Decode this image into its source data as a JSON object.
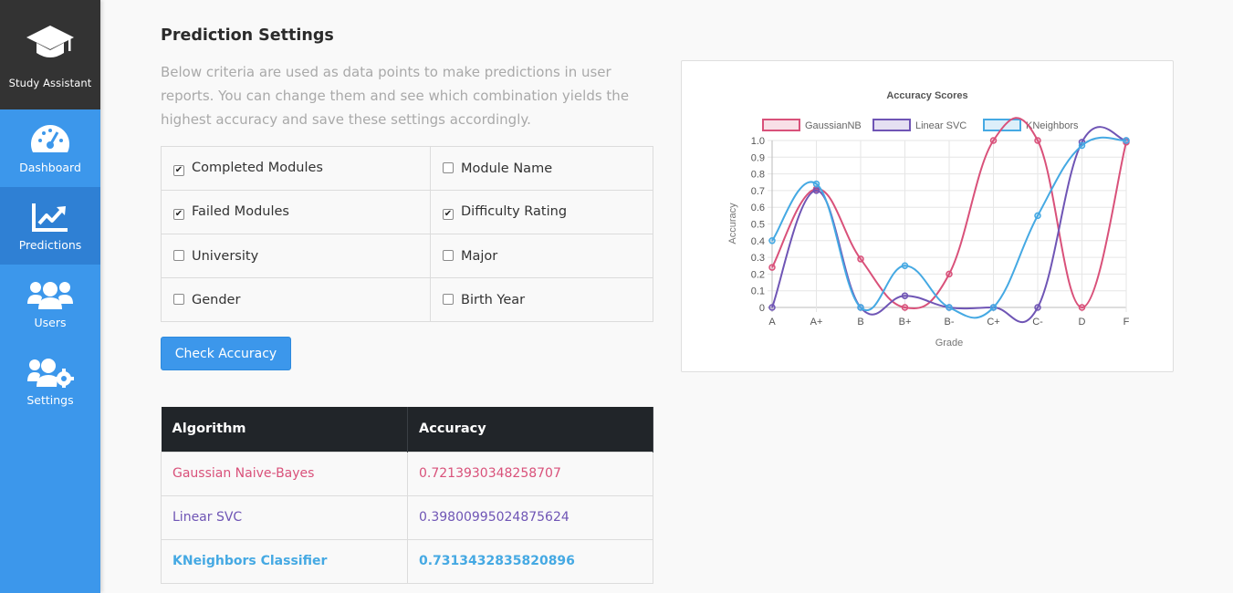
{
  "app": {
    "name": "Study Assistant"
  },
  "sidebar": {
    "items": [
      {
        "label": "Dashboard",
        "icon": "dashboard-gauge-icon"
      },
      {
        "label": "Predictions",
        "icon": "line-chart-icon",
        "active": true
      },
      {
        "label": "Users",
        "icon": "users-icon"
      },
      {
        "label": "Settings",
        "icon": "users-cog-icon"
      }
    ]
  },
  "main": {
    "title": "Prediction Settings",
    "description": "Below criteria are used as data points to make predictions in user reports. You can change them and see which combination yields the highest accuracy and save these settings accordingly.",
    "criteria": [
      [
        {
          "label": "Completed Modules",
          "checked": true
        },
        {
          "label": "Module Name",
          "checked": false
        }
      ],
      [
        {
          "label": "Failed Modules",
          "checked": true
        },
        {
          "label": "Difficulty Rating",
          "checked": true
        }
      ],
      [
        {
          "label": "University",
          "checked": false
        },
        {
          "label": "Major",
          "checked": false
        }
      ],
      [
        {
          "label": "Gender",
          "checked": false
        },
        {
          "label": "Birth Year",
          "checked": false
        }
      ]
    ],
    "check_button": "Check Accuracy",
    "results": {
      "headers": [
        "Algorithm",
        "Accuracy"
      ],
      "rows": [
        {
          "algorithm": "Gaussian Naive-Bayes",
          "accuracy": "0.7213930348258707"
        },
        {
          "algorithm": "Linear SVC",
          "accuracy": "0.39800995024875624"
        },
        {
          "algorithm": "KNeighbors Classifier",
          "accuracy": "0.7313432835820896"
        }
      ]
    }
  },
  "colors": {
    "sidebar": "#3c97eb",
    "brand_bg": "#333333",
    "gaussian": "#d9517a",
    "svc": "#6f55b5",
    "kneighbors": "#45a9e3"
  },
  "chart_data": {
    "type": "line",
    "title": "Accuracy Scores",
    "xlabel": "Grade",
    "ylabel": "Accuracy",
    "categories": [
      "A",
      "A+",
      "B",
      "B+",
      "B-",
      "C+",
      "C-",
      "D",
      "F"
    ],
    "ylim": [
      0,
      1.0
    ],
    "yticks": [
      "0",
      "0.1",
      "0.2",
      "0.3",
      "0.4",
      "0.5",
      "0.6",
      "0.7",
      "0.8",
      "0.9",
      "1.0"
    ],
    "grid": true,
    "legend_position": "top",
    "series": [
      {
        "name": "GaussianNB",
        "color": "#d9517a",
        "values": [
          0.24,
          0.71,
          0.29,
          0.0,
          0.2,
          1.0,
          1.0,
          0.0,
          0.99
        ]
      },
      {
        "name": "Linear SVC",
        "color": "#6f55b5",
        "values": [
          0.0,
          0.7,
          0.0,
          0.07,
          0.0,
          0.0,
          0.0,
          0.99,
          1.0
        ]
      },
      {
        "name": "KNeighbors",
        "color": "#45a9e3",
        "values": [
          0.4,
          0.74,
          0.0,
          0.25,
          0.0,
          0.0,
          0.55,
          0.97,
          1.0
        ]
      }
    ]
  }
}
